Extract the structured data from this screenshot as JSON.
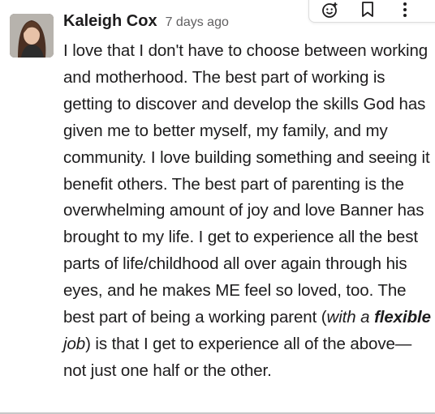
{
  "message": {
    "author": "Kaleigh Cox",
    "timestamp": "7 days ago",
    "text_part1": "I love that I don't have to choose between working and motherhood. The best part of working is getting to discover and develop the skills God has given me to better myself, my family, and my community. I love building something and seeing it benefit others. The best part of parenting is the overwhelming amount of joy and love Banner has brought to my life. I get to experience all the best parts of life/childhood all over again through his eyes, and he makes ME feel so loved, too. The best part of being a working parent (",
    "text_italic1": "with a ",
    "text_bold_italic": "flexible",
    "text_italic2": " job",
    "text_part2": ") is that I get to experience all of the above—not just one half or the other."
  },
  "toolbar": {
    "icons": [
      "add-reaction-icon",
      "bookmark-icon",
      "more-actions-icon"
    ]
  },
  "colors": {
    "text": "#1d1c1d",
    "muted": "#616061",
    "border": "#dddddd"
  }
}
